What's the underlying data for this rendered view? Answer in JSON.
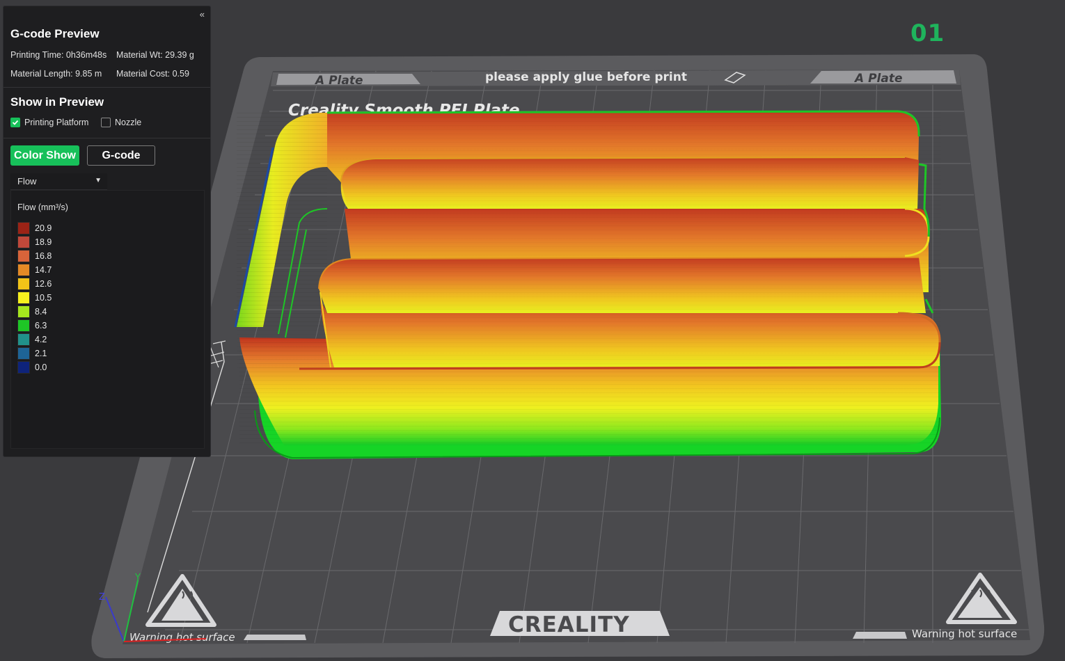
{
  "panel": {
    "collapse_icon": "«",
    "title": "G-code Preview",
    "printing_time": "Printing Time: 0h36m48s",
    "material_wt": "Material Wt: 29.39 g",
    "material_length": "Material Length: 9.85 m",
    "material_cost": "Material Cost: 0.59",
    "show_title": "Show in Preview",
    "printing_platform_label": "Printing Platform",
    "printing_platform_checked": true,
    "nozzle_label": "Nozzle",
    "nozzle_checked": false,
    "color_show_label": "Color Show",
    "gcode_label": "G-code",
    "view_type": "Flow",
    "legend_title": "Flow (mm³/s)",
    "legend": [
      {
        "value": "20.9",
        "color": "#9b2316"
      },
      {
        "value": "18.9",
        "color": "#c0483a"
      },
      {
        "value": "16.8",
        "color": "#d8643a"
      },
      {
        "value": "14.7",
        "color": "#e48a26"
      },
      {
        "value": "12.6",
        "color": "#f2c418"
      },
      {
        "value": "10.5",
        "color": "#f6f01e"
      },
      {
        "value": "8.4",
        "color": "#a6e61e"
      },
      {
        "value": "6.3",
        "color": "#1ec626"
      },
      {
        "value": "4.2",
        "color": "#21918a"
      },
      {
        "value": "2.1",
        "color": "#1e6496"
      },
      {
        "value": "0.0",
        "color": "#0e237a"
      }
    ]
  },
  "plate_number": "01",
  "bed": {
    "left_tab": "A Plate",
    "right_tab": "A Plate",
    "glue_notice": "please apply glue before print",
    "plate_name": "Creality Smooth PEI Plate",
    "brand": "CREALITY",
    "warning_left": "Warning hot surface",
    "warning_right": "Warning hot surface"
  },
  "axes": {
    "z": "Z",
    "y": "Y"
  }
}
